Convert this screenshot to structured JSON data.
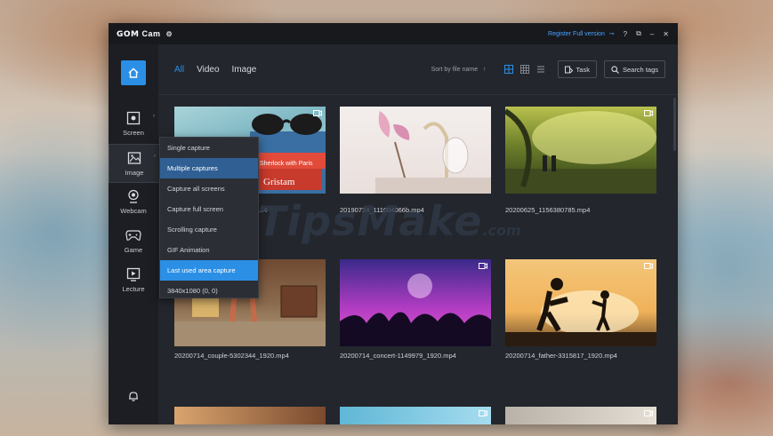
{
  "app": {
    "brand": "GOM",
    "name": "Cam",
    "register_label": "Register Full version",
    "help": "?",
    "restore": "⧉",
    "minimize": "–",
    "close": "✕"
  },
  "sidebar": {
    "items": [
      {
        "label": "Screen"
      },
      {
        "label": "Image"
      },
      {
        "label": "Webcam"
      },
      {
        "label": "Game"
      },
      {
        "label": "Lecture"
      }
    ]
  },
  "toolbar": {
    "tabs": [
      "All",
      "Video",
      "Image"
    ],
    "sort_label": "Sort by file name",
    "sort_arrow": "↑",
    "task_label": "Task",
    "search_label": "Search tags"
  },
  "menu": {
    "items": [
      "Single capture",
      "Multiple captures",
      "Capture all screens",
      "Capture full screen",
      "Scrolling capture",
      "GIF Animation",
      "Last used area capture",
      "3840x1080  (0, 0)"
    ]
  },
  "gallery": {
    "captions": [
      "...4",
      "20190724_111004066b.mp4",
      "20200625_1156380785.mp4",
      "20200714_couple-5302344_1920.mp4",
      "20200714_concert-1149979_1920.mp4",
      "20200714_father-3315817_1920.mp4"
    ]
  },
  "book_text": {
    "line1": "Sherlock with Paris",
    "line2": "Gristam"
  },
  "watermark": {
    "main": "TipsMake",
    "suffix": ".com"
  },
  "colors": {
    "accent": "#2b8fe6",
    "window_bg": "#23262c",
    "sidebar_bg": "#1c1e23"
  }
}
